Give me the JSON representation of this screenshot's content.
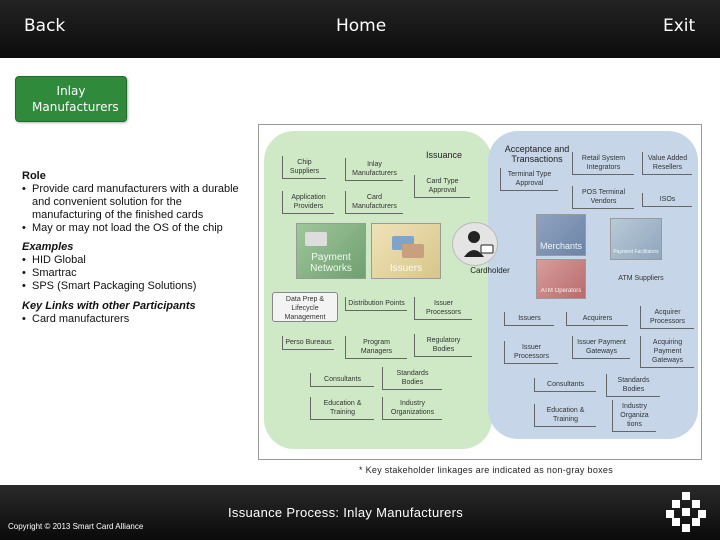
{
  "nav": {
    "back": "Back",
    "home": "Home",
    "exit": "Exit"
  },
  "title_button": "Inlay Manufacturers",
  "role": {
    "heading": "Role",
    "items": [
      "Provide card manufacturers with a durable and convenient solution for the manufacturing of the finished cards",
      "May or may not load the OS of the chip"
    ]
  },
  "examples": {
    "heading": "Examples",
    "items": [
      "HID Global",
      "Smartrac",
      "SPS (Smart Packaging Solutions)"
    ]
  },
  "key_links": {
    "heading": "Key Links with other Participants",
    "items": [
      "Card manufacturers"
    ]
  },
  "diagram": {
    "issuance_head": "Issuance",
    "acceptance_head": "Acceptance and Transactions",
    "chip_suppliers": "Chip Suppliers",
    "inlay_manufacturers": "Inlay Manufacturers",
    "application_providers": "Application Providers",
    "card_manufacturers": "Card Manufacturers",
    "card_type_approval": "Card Type Approval",
    "terminal_type_approval": "Terminal Type Approval",
    "retail_system_integrators": "Retail System Integrators",
    "value_added_resellers": "Value Added Resellers",
    "pos_terminal_vendors": "POS Terminal Vendors",
    "isos": "ISOs",
    "cardholder": "Cardholder",
    "atm_suppliers": "ATM Suppliers",
    "data_prep": "Data Prep & Lifecycle Management",
    "distribution_points": "Distribution Points",
    "issuer_processors_left": "Issuer Processors",
    "perso_bureaus": "Perso Bureaus",
    "program_managers": "Program Managers",
    "regulatory_bodies": "Regulatory Bodies",
    "consultants_left": "Consultants",
    "standards_bodies_left": "Standards Bodies",
    "education_training_left": "Education & Training",
    "industry_organizations_left": "Industry Organizations",
    "issuers": "Issuers",
    "acquirers": "Acquirers",
    "acquirer_processors": "Acquirer Processors",
    "issuer_payment_gateways": "Issuer Payment Gateways",
    "issuer_processors_right": "Issuer Processors",
    "acquiring_payment_gateways": "Acquiring Payment Gateways",
    "consultants_right": "Consultants",
    "standards_bodies_right": "Standards Bodies",
    "education_training_right": "Education & Training",
    "industry_organizations_right": "Industry Organiza tions",
    "tile_payment_networks": "Payment Networks",
    "tile_issuers": "Issuers",
    "tile_merchants": "Merchants",
    "tile_atm_operators": "ATM Operators",
    "tile_payment_facilitators": "Payment Facilitators"
  },
  "footnote": "* Key stakeholder linkages are indicated as non-gray boxes",
  "footer_title": "Issuance Process: Inlay Manufacturers",
  "copyright": "Copyright © 2013 Smart Card Alliance",
  "colors": {
    "title_button": "#2f8a3c",
    "issuance_area": "#cfe9c7",
    "acceptance_area": "#c6d6e8",
    "bars": "#111111"
  },
  "icons": [
    "cardholder-icon",
    "smart-card-alliance-logo"
  ]
}
